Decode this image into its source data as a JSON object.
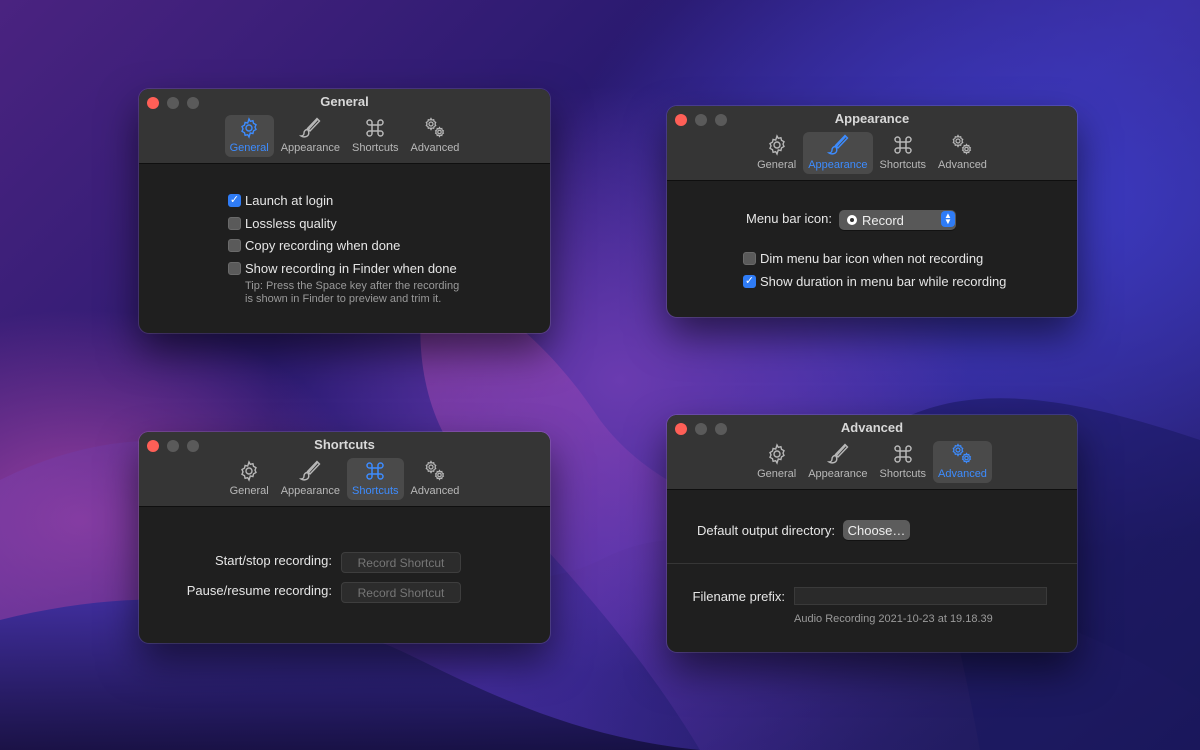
{
  "tabs": [
    {
      "key": "general",
      "label": "General",
      "icon": "gear-icon"
    },
    {
      "key": "appearance",
      "label": "Appearance",
      "icon": "paintbrush-icon"
    },
    {
      "key": "shortcuts",
      "label": "Shortcuts",
      "icon": "command-icon"
    },
    {
      "key": "advanced",
      "label": "Advanced",
      "icon": "gears-icon"
    }
  ],
  "general_window": {
    "title": "General",
    "active_tab": "general",
    "options": [
      {
        "label": "Launch at login",
        "checked": true
      },
      {
        "label": "Lossless quality",
        "checked": false
      },
      {
        "label": "Copy recording when done",
        "checked": false
      },
      {
        "label": "Show recording in Finder when done",
        "checked": false
      }
    ],
    "tip_line1": "Tip: Press the Space key after the recording",
    "tip_line2": "is shown in Finder to preview and trim it."
  },
  "appearance_window": {
    "title": "Appearance",
    "active_tab": "appearance",
    "menu_bar_icon_label": "Menu bar icon:",
    "menu_bar_icon_value": "Record",
    "options": [
      {
        "label": "Dim menu bar icon when not recording",
        "checked": false
      },
      {
        "label": "Show duration in menu bar while recording",
        "checked": true
      }
    ]
  },
  "shortcuts_window": {
    "title": "Shortcuts",
    "active_tab": "shortcuts",
    "start_stop_label": "Start/stop recording:",
    "pause_resume_label": "Pause/resume recording:",
    "record_shortcut_label": "Record Shortcut"
  },
  "advanced_window": {
    "title": "Advanced",
    "active_tab": "advanced",
    "output_dir_label": "Default output directory:",
    "choose_button": "Choose…",
    "filename_prefix_label": "Filename prefix:",
    "filename_prefix_value": "",
    "filename_preview": "Audio Recording 2021-10-23 at 19.18.39"
  },
  "colors": {
    "accent": "#3d8cff",
    "window_bg": "#1f1f1f",
    "titlebar_bg": "#353535",
    "close": "#ff5f57"
  }
}
